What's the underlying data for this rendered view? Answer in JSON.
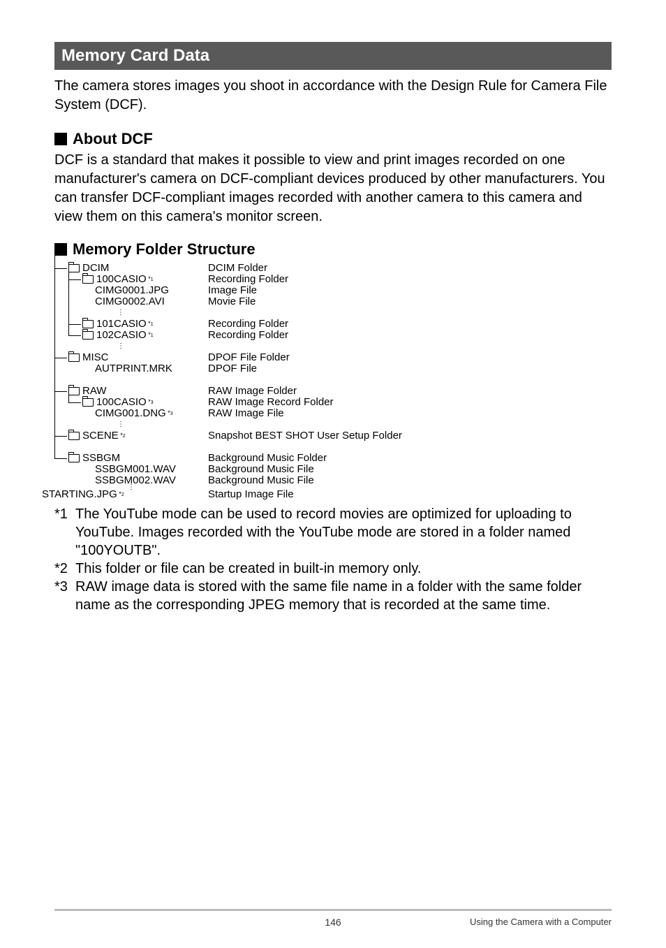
{
  "section_title": "Memory Card Data",
  "intro": "The camera stores images you shoot in accordance with the Design Rule for Camera File System (DCF).",
  "about_dcf_heading": "About DCF",
  "about_dcf_body": "DCF is a standard that makes it possible to view and print images recorded on one manufacturer's camera on DCF-compliant devices produced by other manufacturers. You can transfer DCF-compliant images recorded with another camera to this camera and view them on this camera's monitor screen.",
  "mfs_heading": "Memory Folder Structure",
  "tree": {
    "dcim": "DCIM",
    "dcim_desc": "DCIM Folder",
    "casio100": "100CASIO",
    "casio100_sup": "*1",
    "casio100_desc": "Recording Folder",
    "cimg1": "CIMG0001.JPG",
    "cimg1_desc": "Image File",
    "cimg2": "CIMG0002.AVI",
    "cimg2_desc": "Movie File",
    "casio101": "101CASIO",
    "casio101_sup": "*1",
    "casio101_desc": "Recording Folder",
    "casio102": "102CASIO",
    "casio102_sup": "*1",
    "casio102_desc": "Recording Folder",
    "misc": "MISC",
    "misc_desc": "DPOF File Folder",
    "autprint": "AUTPRINT.MRK",
    "autprint_desc": "DPOF File",
    "raw": "RAW",
    "raw_desc": "RAW Image Folder",
    "raw100": "100CASIO",
    "raw100_sup": "*3",
    "raw100_desc": "RAW Image Record Folder",
    "rawfile": "CIMG001.DNG",
    "rawfile_sup": "*3",
    "rawfile_desc": "RAW Image File",
    "scene": "SCENE",
    "scene_sup": "*2",
    "scene_desc": "Snapshot BEST SHOT User Setup Folder",
    "ssbgm": "SSBGM",
    "ssbgm_desc": "Background Music Folder",
    "ssbgm1": "SSBGM001.WAV",
    "ssbgm1_desc": "Background Music File",
    "ssbgm2": "SSBGM002.WAV",
    "ssbgm2_desc": "Background Music File",
    "starting": "STARTING.JPG",
    "starting_sup": "*2",
    "starting_desc": "Startup Image File"
  },
  "footnotes": {
    "f1_marker": "*1",
    "f1": "The YouTube mode can be used to record movies are optimized for uploading to YouTube. Images recorded with the YouTube mode are stored in a folder named \"100YOUTB\".",
    "f2_marker": "*2",
    "f2": "This folder or file can be created in built-in memory only.",
    "f3_marker": "*3",
    "f3": "RAW image data is stored with the same file name in a folder with the same folder name as the corresponding JPEG memory that is recorded at the same time."
  },
  "footer": {
    "page": "146",
    "section": "Using the Camera with a Computer"
  }
}
